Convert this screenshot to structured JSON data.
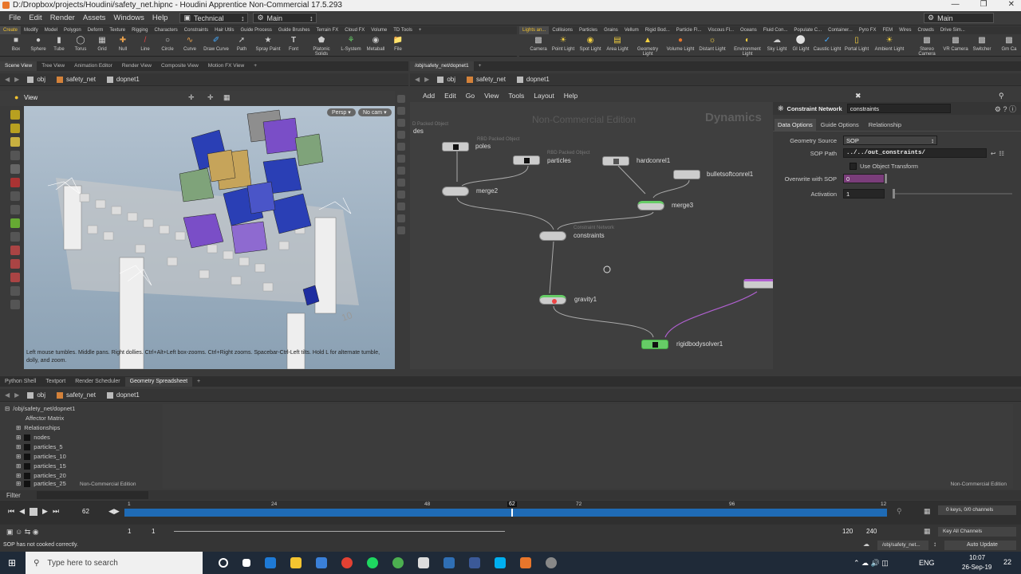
{
  "window": {
    "title": "D:/Dropbox/projects/Houdini/safety_net.hipnc - Houdini Apprentice Non-Commercial 17.5.293"
  },
  "menu": {
    "items": [
      "File",
      "Edit",
      "Render",
      "Assets",
      "Windows",
      "Help"
    ],
    "desktop": "Technical",
    "main": "Main",
    "right_desk": "Main"
  },
  "shelf_left": {
    "tabs": [
      "Create",
      "Modify",
      "Model",
      "Polygon",
      "Deform",
      "Texture",
      "Rigging",
      "Characters",
      "Constraints",
      "Hair Utils",
      "Guide Process",
      "Guide Brushes",
      "Terrain FX",
      "Cloud FX",
      "Volume",
      "TD Tools"
    ],
    "tools": [
      "Box",
      "Sphere",
      "Tube",
      "Torus",
      "Grid",
      "Null",
      "Line",
      "Circle",
      "Curve",
      "Draw Curve",
      "Path",
      "Spray Paint",
      "Font",
      "Platonic Solids",
      "L-System",
      "Metaball",
      "File"
    ]
  },
  "shelf_right": {
    "tabs": [
      "Lights an...",
      "Collisions",
      "Particles",
      "Grains",
      "Vellum",
      "Rigid Bod...",
      "Particle Fl...",
      "Viscous Fl...",
      "Oceans",
      "Fluid Con...",
      "Populate C...",
      "Container...",
      "Pyro FX",
      "FEM",
      "Wires",
      "Crowds",
      "Drive Sim..."
    ],
    "tools": [
      "Camera",
      "Point Light",
      "Spot Light",
      "Area Light",
      "Geometry Light",
      "Volume Light",
      "Distant Light",
      "Environment Light",
      "Sky Light",
      "GI Light",
      "Caustic Light",
      "Portal Light",
      "Ambient Light",
      "Stereo Camera",
      "VR Camera",
      "Switcher",
      "Gm Ca"
    ]
  },
  "left_pane": {
    "tabs": [
      "Scene View",
      "Tree View",
      "Animation Editor",
      "Render View",
      "Composite View",
      "Motion FX View"
    ],
    "path": [
      "obj",
      "safety_net",
      "dopnet1"
    ],
    "view_label": "View",
    "persp": "Persp",
    "cam": "No cam",
    "hint": "Left mouse tumbles. Middle pans. Right dollies. Ctrl+Alt+Left box-zooms. Ctrl+Right zooms. Spacebar-Ctrl-Left tilts. Hold L for alternate tumble, dolly, and zoom.",
    "ground_num": "10"
  },
  "right_pane": {
    "tab": "/obj/safety_net/dopnet1",
    "path": [
      "obj",
      "safety_net",
      "dopnet1"
    ],
    "menu": [
      "Add",
      "Edit",
      "Go",
      "View",
      "Tools",
      "Layout",
      "Help"
    ],
    "watermark": "Non-Commercial Edition",
    "context": "Dynamics",
    "nodes": [
      {
        "label": "poles",
        "sub": "D Packed Object",
        "sub2": "RBD Packed Object"
      },
      {
        "label": "particles",
        "sub": "RBD Packed Object"
      },
      {
        "label": "hardconrel1"
      },
      {
        "label": "bulletsoftconrel1"
      },
      {
        "label": "merge2"
      },
      {
        "label": "merge3"
      },
      {
        "label": "constraints",
        "sub": "Constraint Network"
      },
      {
        "label": "gravity1"
      },
      {
        "label": "rigidbodysolver1"
      }
    ],
    "trunc": "des"
  },
  "parms": {
    "node_type": "Constraint Network",
    "node_name": "constraints",
    "tabs": [
      "Data Options",
      "Guide Options",
      "Relationship"
    ],
    "geometry_source_label": "Geometry Source",
    "geometry_source": "SOP",
    "sop_path_label": "SOP Path",
    "sop_path": "../../out_constraints/",
    "use_object_transform": "Use Object Transform",
    "overwrite_label": "Overwrite with SOP",
    "overwrite_value": "0",
    "activation_label": "Activation",
    "activation_value": "1"
  },
  "bottom": {
    "tabs": [
      "Python Shell",
      "Textport",
      "Render Scheduler",
      "Geometry Spreadsheet"
    ],
    "path": [
      "obj",
      "safety_net",
      "dopnet1"
    ],
    "tree": [
      "/obj/safety_net/dopnet1",
      "Affector Matrix",
      "Relationships",
      "nodes",
      "particles_5",
      "particles_10",
      "particles_15",
      "particles_20",
      "particles_25"
    ],
    "watermark": "Non-Commercial Edition",
    "watermark2": "Non-Commercial Edition",
    "filter": "Filter"
  },
  "timeline": {
    "frame": "62",
    "ticks": [
      "1",
      "24",
      "48",
      "72",
      "96",
      "12"
    ],
    "current": "62",
    "start": "1",
    "start2": "1",
    "end": "120",
    "end2": "240",
    "keys": "0 keys, 0/0 channels",
    "all_channels": "Key All Channels"
  },
  "status": {
    "message": "SOP has not cooked correctly.",
    "path": "/obj/safety_net...",
    "auto_update": "Auto Update"
  },
  "taskbar": {
    "search": "Type here to search",
    "lang": "ENG",
    "time": "10:07",
    "date": "26-Sep-19",
    "notif": "22"
  }
}
